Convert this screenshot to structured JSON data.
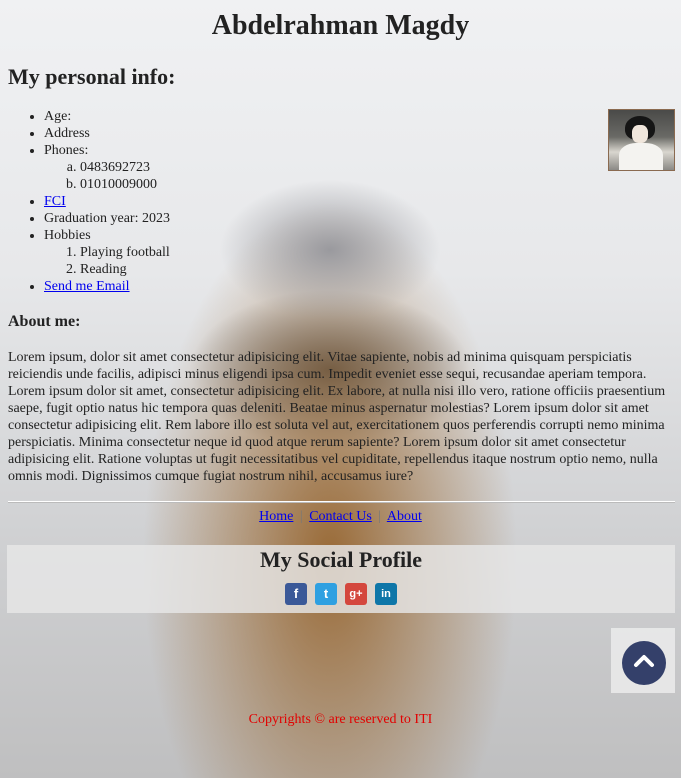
{
  "header": {
    "title": "Abdelrahman Magdy",
    "section_title": "My personal info:"
  },
  "info": {
    "age": "Age:",
    "address": "Address",
    "phones_label": "Phones:",
    "phones": [
      "0483692723",
      "01010009000"
    ],
    "fci_link": "FCI",
    "graduation": "Graduation year: 2023",
    "hobbies_label": "Hobbies",
    "hobbies": [
      "Playing football",
      "Reading"
    ],
    "email_link": "Send me Email"
  },
  "about": {
    "heading": "About me:",
    "text": "Lorem ipsum, dolor sit amet consectetur adipisicing elit. Vitae sapiente, nobis ad minima quisquam perspiciatis reiciendis unde facilis, adipisci minus eligendi ipsa cum. Impedit eveniet esse sequi, recusandae aperiam tempora. Lorem ipsum dolor sit amet, consectetur adipisicing elit. Ex labore, at nulla nisi illo vero, ratione officiis praesentium saepe, fugit optio natus hic tempora quas deleniti. Beatae minus aspernatur molestias? Lorem ipsum dolor sit amet consectetur adipisicing elit. Rem labore illo est soluta vel aut, exercitationem quos perferendis corrupti nemo minima perspiciatis. Minima consectetur neque id quod atque rerum sapiente? Lorem ipsum dolor sit amet consectetur adipisicing elit. Ratione voluptas ut fugit necessitatibus vel cupiditate, repellendus itaque nostrum optio nemo, nulla omnis modi. Dignissimos cumque fugiat nostrum nihil, accusamus iure?"
  },
  "nav": {
    "home": "Home",
    "contact": "Contact Us",
    "about": "About",
    "separator": "|"
  },
  "social": {
    "heading": "My Social Profile",
    "icons": [
      "facebook-icon",
      "twitter-icon",
      "google-plus-icon",
      "linkedin-icon"
    ],
    "facebook_glyph": "f",
    "twitter_glyph": "t",
    "google_glyph": "g+",
    "linkedin_glyph": "in"
  },
  "footer": {
    "copyright": "Copyrights © are reserved to ITI"
  },
  "colors": {
    "link": "#0000ee",
    "copyright": "#e20000",
    "back_to_top": "#34406a"
  }
}
